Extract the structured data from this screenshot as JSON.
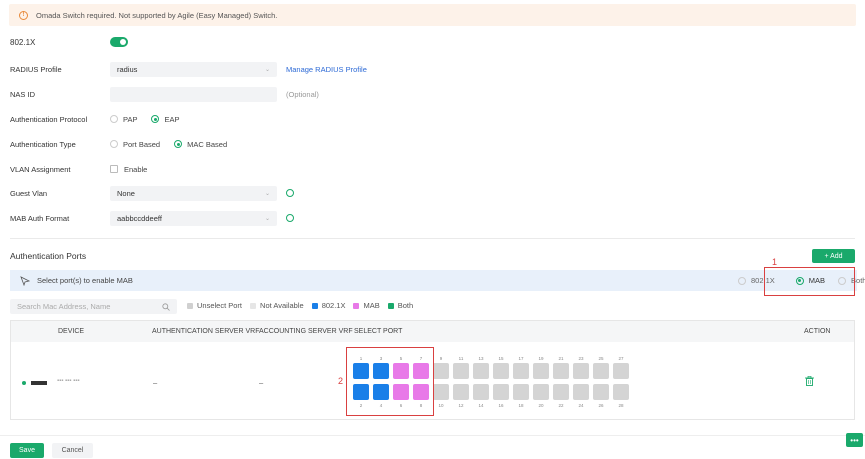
{
  "banner": {
    "text": "Omada Switch required. Not supported by Agile (Easy Managed) Switch."
  },
  "form": {
    "dot1x_label": "802.1X",
    "dot1x_enabled": true,
    "radius_profile": {
      "label": "RADIUS Profile",
      "value": "radius",
      "link": "Manage RADIUS Profile"
    },
    "nas_id": {
      "label": "NAS ID",
      "value": "",
      "hint": "(Optional)"
    },
    "auth_protocol": {
      "label": "Authentication Protocol",
      "options": [
        "PAP",
        "EAP"
      ],
      "selected": "EAP"
    },
    "auth_type": {
      "label": "Authentication Type",
      "options": [
        "Port Based",
        "MAC Based"
      ],
      "selected": "MAC Based"
    },
    "vlan_assignment": {
      "label": "VLAN Assignment",
      "checkbox_label": "Enable",
      "checked": false
    },
    "guest_vlan": {
      "label": "Guest Vlan",
      "value": "None"
    },
    "mab_format": {
      "label": "MAB Auth Format",
      "value": "aabbccddeeff"
    }
  },
  "ports_section": {
    "title": "Authentication Ports",
    "add_label": "+ Add",
    "mab_bar_text": "Select port(s) to enable MAB",
    "mode_options": [
      "802.1X",
      "MAB",
      "Both"
    ],
    "mode_selected": "MAB",
    "annotation_1": "1",
    "annotation_2": "2",
    "search_placeholder": "Search Mac Address, Name",
    "legend": [
      {
        "label": "Unselect Port",
        "color": "#d0d0d0"
      },
      {
        "label": "Not Available",
        "color": "#e6e6e6"
      },
      {
        "label": "802.1X",
        "color": "#1a7fe8"
      },
      {
        "label": "MAB",
        "color": "#e879e8"
      },
      {
        "label": "Both",
        "color": "#1aa96b"
      }
    ],
    "columns": [
      "DEVICE",
      "AUTHENTICATION SERVER VRF",
      "ACCOUNTING SERVER VRF",
      "SELECT PORT",
      "ACTION"
    ],
    "row": {
      "auth_vrf": "–",
      "acct_vrf": "–",
      "top_ports": [
        "1",
        "3",
        "5",
        "7",
        "9",
        "11",
        "13",
        "15",
        "17",
        "19",
        "21",
        "23",
        "25",
        "27"
      ],
      "bottom_ports": [
        "2",
        "4",
        "6",
        "8",
        "10",
        "12",
        "14",
        "16",
        "18",
        "20",
        "22",
        "24",
        "26",
        "28"
      ],
      "top_states": [
        "8021x",
        "8021x",
        "mab",
        "mab",
        "none",
        "none",
        "none",
        "none",
        "none",
        "none",
        "none",
        "none",
        "none",
        "none"
      ],
      "bottom_states": [
        "8021x",
        "8021x",
        "mab",
        "mab",
        "none",
        "none",
        "none",
        "none",
        "none",
        "none",
        "none",
        "none",
        "none",
        "none"
      ]
    }
  },
  "footer": {
    "save": "Save",
    "cancel": "Cancel"
  }
}
